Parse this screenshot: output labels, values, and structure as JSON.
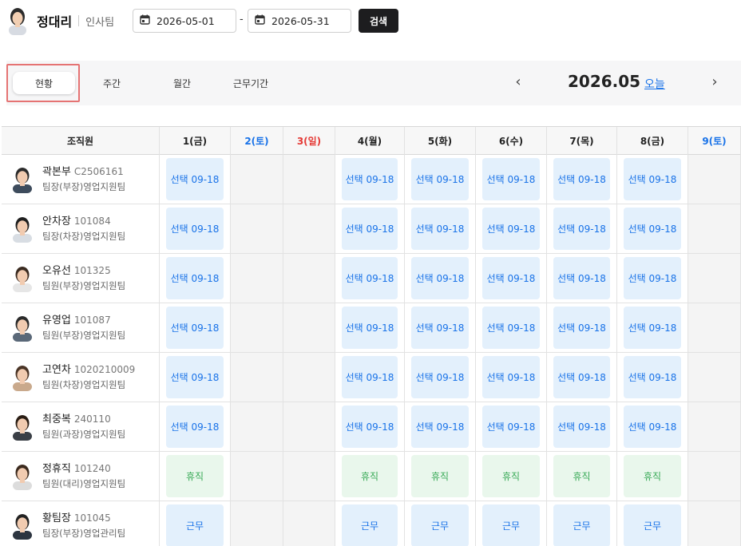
{
  "header": {
    "user_name": "정대리",
    "team": "인사팀",
    "start_date": "2026-05-01",
    "end_date": "2026-05-31",
    "separator": "-",
    "search_label": "검색"
  },
  "view": {
    "tabs": [
      {
        "label": "현황",
        "active": true
      },
      {
        "label": "주간"
      },
      {
        "label": "월간"
      },
      {
        "label": "근무기간"
      }
    ],
    "month_title": "2026.05",
    "today_label": "오늘",
    "prev_icon": "chevron-left-icon",
    "next_icon": "chevron-right-icon"
  },
  "table": {
    "org_header": "조직원",
    "days": [
      {
        "label": "1(금)",
        "type": "weekday"
      },
      {
        "label": "2(토)",
        "type": "sat"
      },
      {
        "label": "3(일)",
        "type": "sun"
      },
      {
        "label": "4(월)",
        "type": "weekday"
      },
      {
        "label": "5(화)",
        "type": "weekday"
      },
      {
        "label": "6(수)",
        "type": "weekday"
      },
      {
        "label": "7(목)",
        "type": "weekday"
      },
      {
        "label": "8(금)",
        "type": "weekday"
      },
      {
        "label": "9(토)",
        "type": "sat"
      }
    ],
    "employees": [
      {
        "name": "곽본부",
        "id": "C2506161",
        "dept": "팀장(부장)영업지원팀",
        "schedule": [
          "선택 09-18",
          "",
          "",
          "선택 09-18",
          "선택 09-18",
          "선택 09-18",
          "선택 09-18",
          "선택 09-18",
          ""
        ],
        "kind": "work"
      },
      {
        "name": "안차장",
        "id": "101084",
        "dept": "팀장(차장)영업지원팀",
        "schedule": [
          "선택 09-18",
          "",
          "",
          "선택 09-18",
          "선택 09-18",
          "선택 09-18",
          "선택 09-18",
          "선택 09-18",
          ""
        ],
        "kind": "work"
      },
      {
        "name": "오유선",
        "id": "101325",
        "dept": "팀원(부장)영업지원팀",
        "schedule": [
          "선택 09-18",
          "",
          "",
          "선택 09-18",
          "선택 09-18",
          "선택 09-18",
          "선택 09-18",
          "선택 09-18",
          ""
        ],
        "kind": "work"
      },
      {
        "name": "유영업",
        "id": "101087",
        "dept": "팀원(부장)영업지원팀",
        "schedule": [
          "선택 09-18",
          "",
          "",
          "선택 09-18",
          "선택 09-18",
          "선택 09-18",
          "선택 09-18",
          "선택 09-18",
          ""
        ],
        "kind": "work"
      },
      {
        "name": "고연차",
        "id": "1020210009",
        "dept": "팀원(차장)영업지원팀",
        "schedule": [
          "선택 09-18",
          "",
          "",
          "선택 09-18",
          "선택 09-18",
          "선택 09-18",
          "선택 09-18",
          "선택 09-18",
          ""
        ],
        "kind": "work"
      },
      {
        "name": "최중복",
        "id": "240110",
        "dept": "팀원(과장)영업지원팀",
        "schedule": [
          "선택 09-18",
          "",
          "",
          "선택 09-18",
          "선택 09-18",
          "선택 09-18",
          "선택 09-18",
          "선택 09-18",
          ""
        ],
        "kind": "work"
      },
      {
        "name": "정휴직",
        "id": "101240",
        "dept": "팀원(대리)영업지원팀",
        "schedule": [
          "휴직",
          "",
          "",
          "휴직",
          "휴직",
          "휴직",
          "휴직",
          "휴직",
          ""
        ],
        "kind": "leave"
      },
      {
        "name": "황팀장",
        "id": "101045",
        "dept": "팀장(부장)영업관리팀",
        "schedule": [
          "근무",
          "",
          "",
          "근무",
          "근무",
          "근무",
          "근무",
          "근무",
          ""
        ],
        "kind": "work"
      }
    ]
  },
  "colors": {
    "accent": "#1a73e8",
    "sunday": "#e53935",
    "leave": "#34a853",
    "work_chip_bg": "#e3f0fc",
    "leave_chip_bg": "#e9f7ec",
    "highlight_border": "#e57373",
    "search_btn_bg": "#1d1d1f"
  }
}
